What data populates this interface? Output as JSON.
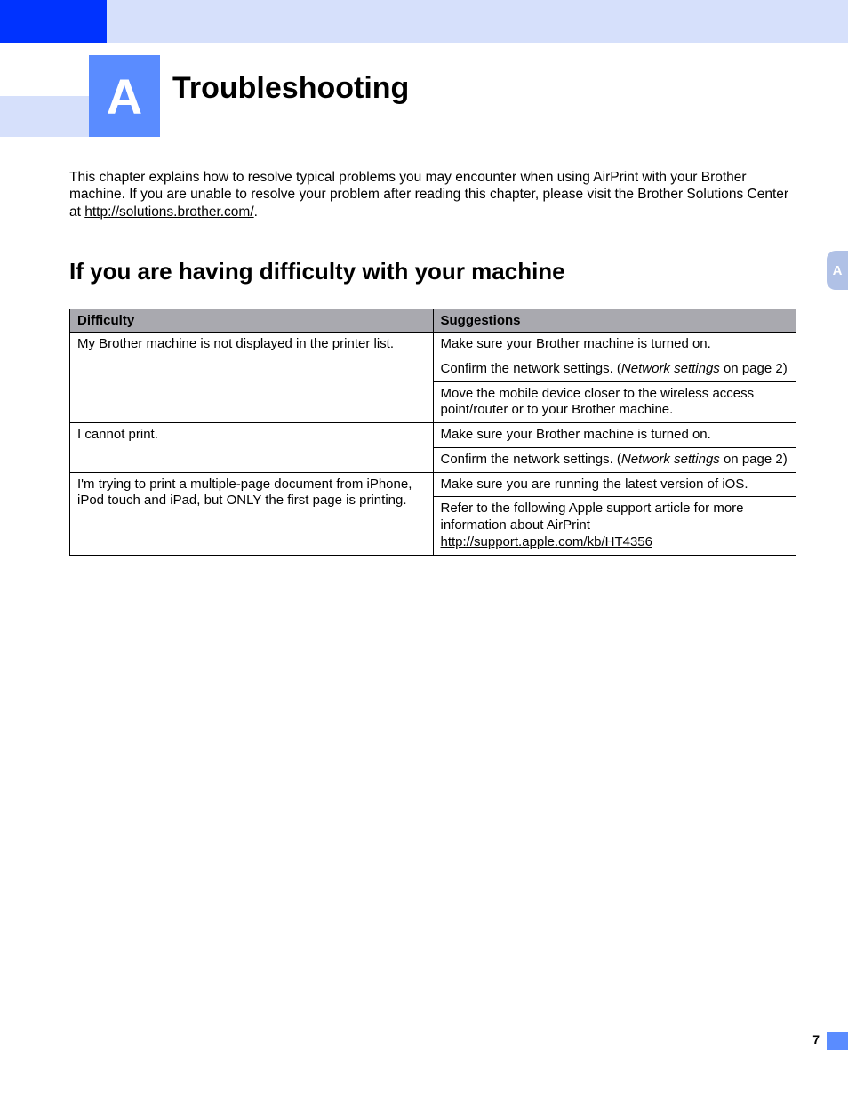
{
  "chapter": {
    "letter": "A",
    "title": "Troubleshooting"
  },
  "intro": {
    "before_link": "This chapter explains how to resolve typical problems you may encounter when using AirPrint with your Brother machine. If you are unable to resolve your problem after reading this chapter, please visit the Brother Solutions Center at ",
    "link_text": "http://solutions.brother.com/",
    "after_link": "."
  },
  "subheading": "If you are having difficulty with your machine",
  "side_tab": "A",
  "table": {
    "header_difficulty": "Difficulty",
    "header_suggestions": "Suggestions",
    "rows": [
      {
        "difficulty": "My Brother machine is not displayed in the printer list.",
        "suggestions": [
          {
            "text": "Make sure your Brother machine is turned on."
          },
          {
            "prefix": "Confirm the network settings. (",
            "italic": "Network settings",
            "suffix": " on page 2)"
          },
          {
            "text": "Move the mobile device closer to the wireless access point/router or to your Brother machine."
          }
        ]
      },
      {
        "difficulty": "I cannot print.",
        "suggestions": [
          {
            "text": "Make sure your Brother machine is turned on."
          },
          {
            "prefix": "Confirm the network settings. (",
            "italic": "Network settings",
            "suffix": " on page 2)"
          }
        ]
      },
      {
        "difficulty": "I'm trying to print a multiple-page document from iPhone, iPod touch and iPad, but ONLY the first page is printing.",
        "suggestions": [
          {
            "text": "Make sure you are running the latest version of iOS."
          },
          {
            "prefix": "Refer to the following Apple support article for more information about AirPrint ",
            "link": "http://support.apple.com/kb/HT4356"
          }
        ]
      }
    ]
  },
  "page_number": "7"
}
